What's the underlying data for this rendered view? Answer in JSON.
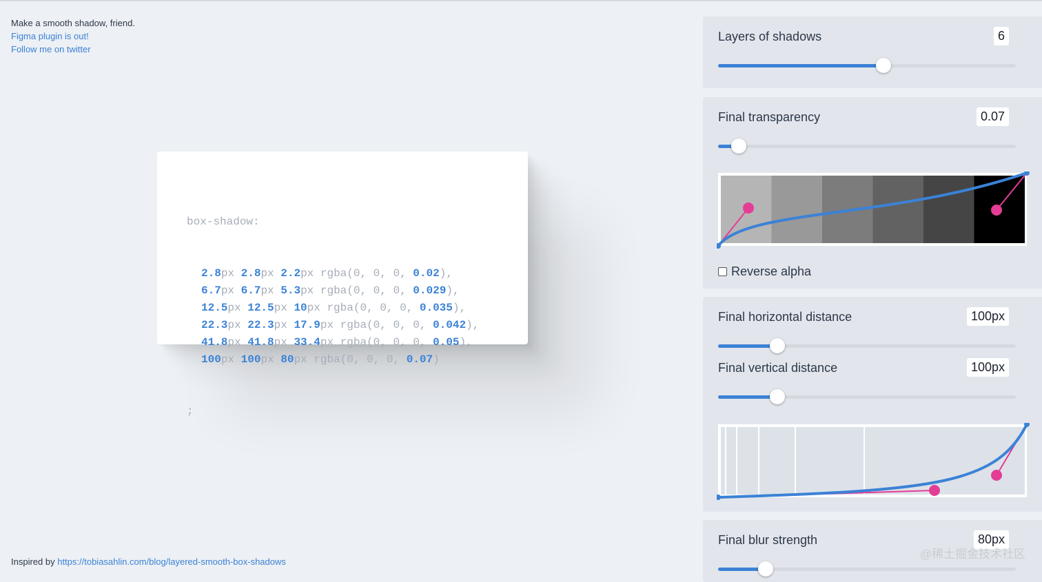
{
  "intro": {
    "tagline": "Make a smooth shadow, friend.",
    "figma_link": "Figma plugin is out!",
    "twitter_link": "Follow me on twitter"
  },
  "footer": {
    "prefix": "Inspired by",
    "link": "https://tobiasahlin.com/blog/layered-smooth-box-shadows"
  },
  "code": {
    "property": "box-shadow:",
    "lines": [
      [
        "2.8",
        "2.8",
        "2.2",
        "0.02",
        "),"
      ],
      [
        "6.7",
        "6.7",
        "5.3",
        "0.029",
        "),"
      ],
      [
        "12.5",
        "12.5",
        "10",
        "0.035",
        "),"
      ],
      [
        "22.3",
        "22.3",
        "17.9",
        "0.042",
        "),"
      ],
      [
        "41.8",
        "41.8",
        "33.4",
        "0.05",
        "),"
      ],
      [
        "100",
        "100",
        "80",
        "0.07",
        ")"
      ]
    ],
    "terminator": ";"
  },
  "controls": {
    "layers": {
      "label": "Layers of shadows",
      "value": "6",
      "fraction": 0.556
    },
    "transparency": {
      "label": "Final transparency",
      "value": "0.07",
      "fraction": 0.07
    },
    "reverse_alpha": {
      "label": "Reverse alpha",
      "checked": false
    },
    "horizontal": {
      "label": "Final horizontal distance",
      "value": "100px",
      "fraction": 0.2
    },
    "vertical": {
      "label": "Final vertical distance",
      "value": "100px",
      "fraction": 0.2
    },
    "blur": {
      "label": "Final blur strength",
      "value": "80px",
      "fraction": 0.16
    }
  },
  "colors": {
    "accent": "#3b82d6",
    "handle": "#e33d95"
  },
  "watermark": "@稀土掘金技术社区"
}
